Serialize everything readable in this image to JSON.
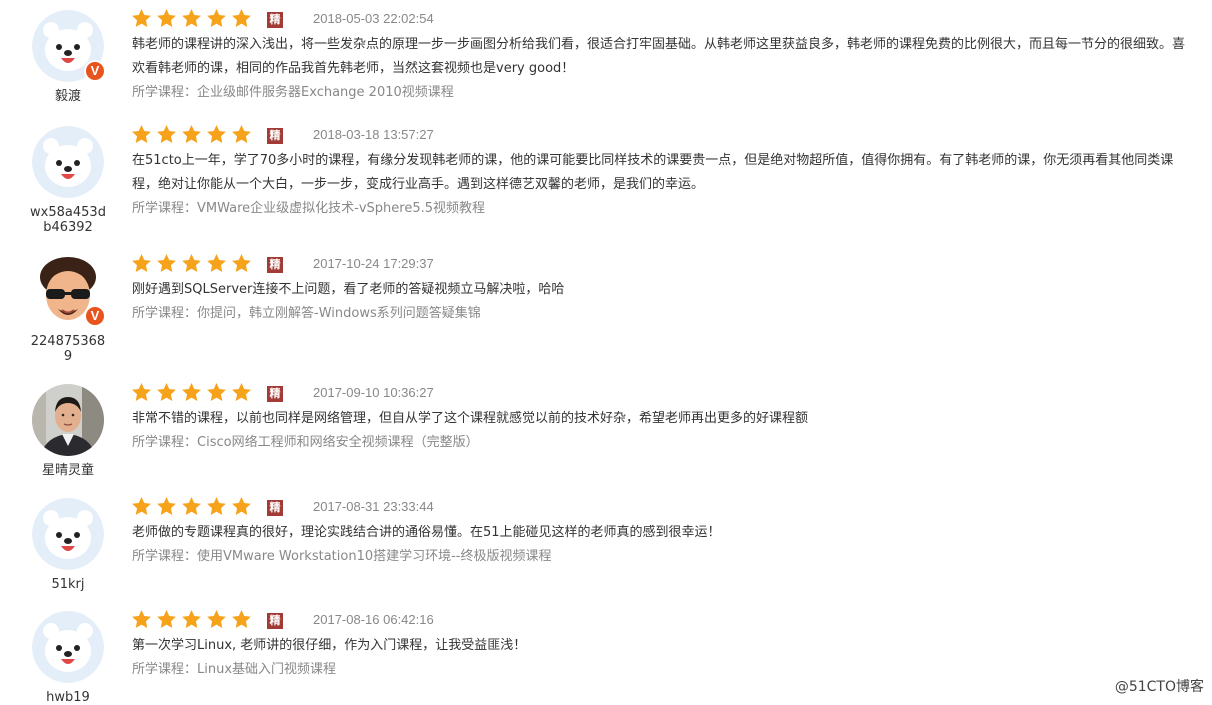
{
  "reviews": [
    {
      "username": "毅渡",
      "avatar": "bear-avatar",
      "vip": true,
      "date": "2018-05-03 22:02:54",
      "badge": "精",
      "rating": 5,
      "text": "韩老师的课程讲的深入浅出，将一些发杂点的原理一步一步画图分析给我们看，很适合打牢固基础。从韩老师这里获益良多，韩老师的课程免费的比例很大，而且每一节分的很细致。喜欢看韩老师的课，相同的作品我首先韩老师，当然这套视频也是very good！",
      "course_label": "所学课程：",
      "course": "企业级邮件服务器Exchange 2010视频课程"
    },
    {
      "username": "wx58a453db46392",
      "avatar": "bear-avatar",
      "vip": false,
      "date": "2018-03-18 13:57:27",
      "badge": "精",
      "rating": 5,
      "text": "在51cto上一年，学了70多小时的课程，有缘分发现韩老师的课，他的课可能要比同样技术的课要贵一点，但是绝对物超所值，值得你拥有。有了韩老师的课，你无须再看其他同类课程，绝对让你能从一个大白，一步一步，变成行业高手。遇到这样德艺双馨的老师，是我们的幸运。",
      "course_label": "所学课程：",
      "course": "VMWare企业级虚拟化技术-vSphere5.5视频教程"
    },
    {
      "username": "2248753689",
      "avatar": "sunglasses-avatar",
      "vip": true,
      "date": "2017-10-24 17:29:37",
      "badge": "精",
      "rating": 5,
      "text": "刚好遇到SQLServer连接不上问题，看了老师的答疑视频立马解决啦，哈哈",
      "course_label": "所学课程：",
      "course": "你提问，韩立刚解答-Windows系列问题答疑集锦"
    },
    {
      "username": "星晴灵童",
      "avatar": "photo-avatar",
      "vip": false,
      "date": "2017-09-10 10:36:27",
      "badge": "精",
      "rating": 5,
      "text": "非常不错的课程，以前也同样是网络管理，但自从学了这个课程就感觉以前的技术好杂，希望老师再出更多的好课程额",
      "course_label": "所学课程：",
      "course": "Cisco网络工程师和网络安全视频课程（完整版）"
    },
    {
      "username": "51krj",
      "avatar": "bear-avatar",
      "vip": false,
      "date": "2017-08-31 23:33:44",
      "badge": "精",
      "rating": 5,
      "text": "老师做的专题课程真的很好，理论实践结合讲的通俗易懂。在51上能碰见这样的老师真的感到很幸运！",
      "course_label": "所学课程：",
      "course": "使用VMware Workstation10搭建学习环境--终极版视频课程"
    },
    {
      "username": "hwb19",
      "avatar": "bear-avatar",
      "vip": false,
      "date": "2017-08-16 06:42:16",
      "badge": "精",
      "rating": 5,
      "text": "第一次学习Linux, 老师讲的很仔细，作为入门课程，让我受益匪浅！",
      "course_label": "所学课程：",
      "course": "Linux基础入门视频课程"
    }
  ],
  "watermark": "@51CTO博客",
  "colors": {
    "star": "#f7a21b",
    "badge": "#a23b35",
    "vip_badge": "#e8541e",
    "meta_text": "#888888",
    "bear_bg": "#e3eef8"
  }
}
